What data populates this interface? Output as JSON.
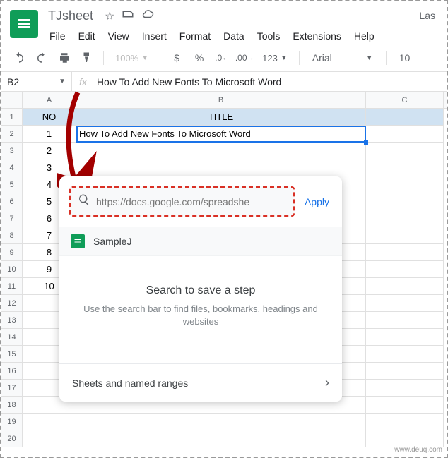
{
  "doc_title": "TJsheet",
  "menubar": [
    "File",
    "Edit",
    "View",
    "Insert",
    "Format",
    "Data",
    "Tools",
    "Extensions",
    "Help"
  ],
  "last_edit": "Las",
  "toolbar": {
    "zoom": "100%",
    "symbols": [
      "$",
      "%"
    ],
    "format": "123",
    "font": "Arial",
    "font_size": "10"
  },
  "formula": {
    "cell_ref": "B2",
    "content": "How To Add New Fonts To Microsoft Word"
  },
  "columns": [
    "A",
    "B",
    "C"
  ],
  "header_row": {
    "a": "NO",
    "b": "TITLE"
  },
  "rows": [
    {
      "n": "1",
      "a": "1",
      "b": "How To Add New Fonts To Microsoft Word"
    },
    {
      "n": "2",
      "a": "2",
      "b": ""
    },
    {
      "n": "3",
      "a": "3",
      "b": ""
    },
    {
      "n": "4",
      "a": "4",
      "b": ""
    },
    {
      "n": "5",
      "a": "5",
      "b": ""
    },
    {
      "n": "6",
      "a": "6",
      "b": ""
    },
    {
      "n": "7",
      "a": "7",
      "b": ""
    },
    {
      "n": "8",
      "a": "8",
      "b": ""
    },
    {
      "n": "9",
      "a": "9",
      "b": ""
    },
    {
      "n": "10",
      "a": "10",
      "b": ""
    },
    {
      "n": "11",
      "a": "",
      "b": ""
    },
    {
      "n": "12",
      "a": "",
      "b": ""
    },
    {
      "n": "13",
      "a": "",
      "b": ""
    },
    {
      "n": "14",
      "a": "",
      "b": ""
    },
    {
      "n": "15",
      "a": "",
      "b": ""
    },
    {
      "n": "16",
      "a": "",
      "b": ""
    },
    {
      "n": "17",
      "a": "",
      "b": ""
    },
    {
      "n": "18",
      "a": "",
      "b": ""
    },
    {
      "n": "19",
      "a": "",
      "b": ""
    }
  ],
  "link_popup": {
    "search_placeholder": "https://docs.google.com/spreadshe",
    "apply": "Apply",
    "result": "SampleJ",
    "empty_title": "Search to save a step",
    "empty_sub": "Use the search bar to find files, bookmarks, headings and websites",
    "footer": "Sheets and named ranges"
  },
  "watermark": "www.deuq.com"
}
